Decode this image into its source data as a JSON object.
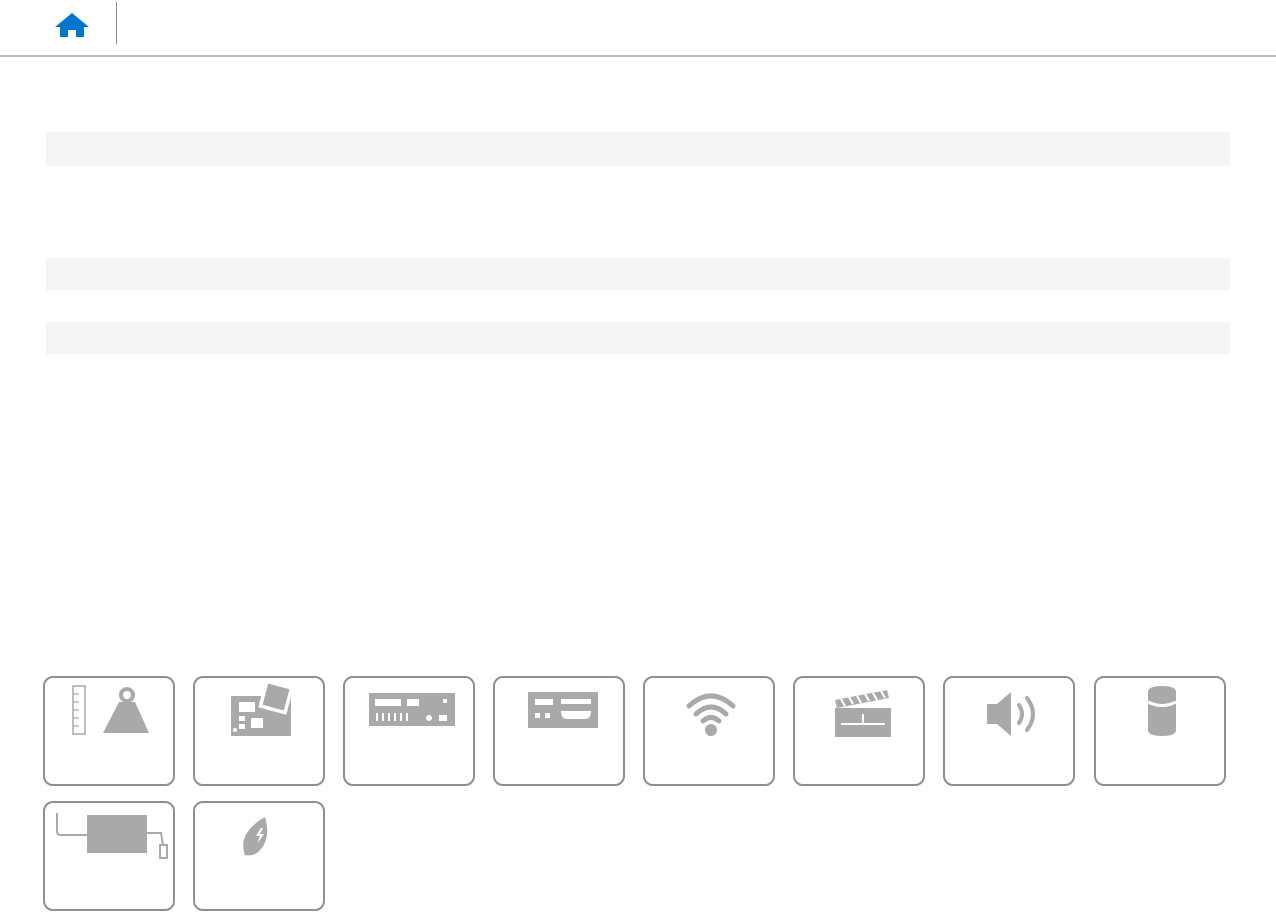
{
  "header": {
    "home_icon": "home-icon",
    "home_color": "#0076ce"
  },
  "content": {
    "stripe_color": "#f4f4f4"
  },
  "tiles": [
    {
      "icon": "dimensions-weight-icon",
      "label": ""
    },
    {
      "icon": "system-board-icon",
      "label": ""
    },
    {
      "icon": "ports-connectors-icon",
      "label": ""
    },
    {
      "icon": "front-panel-icon",
      "label": ""
    },
    {
      "icon": "wireless-icon",
      "label": ""
    },
    {
      "icon": "media-card-icon",
      "label": ""
    },
    {
      "icon": "audio-icon",
      "label": ""
    },
    {
      "icon": "storage-icon",
      "label": ""
    },
    {
      "icon": "power-adapter-icon",
      "label": ""
    },
    {
      "icon": "energy-icon",
      "label": ""
    }
  ],
  "colors": {
    "icon_gray": "#a9a9a9",
    "tile_border": "#8f8f8f",
    "header_rule": "#bdbdbd"
  }
}
